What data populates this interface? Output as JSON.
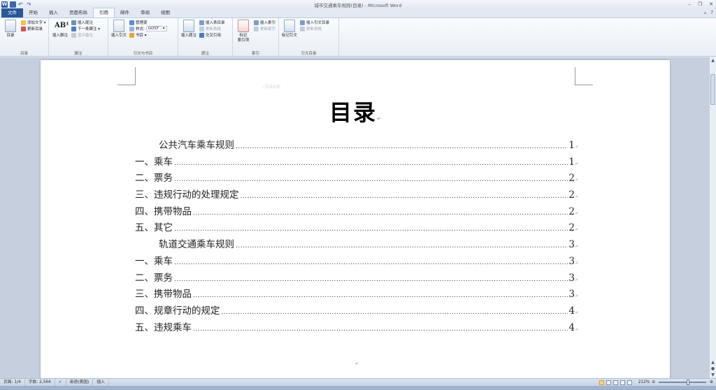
{
  "window": {
    "title": "城市交通乘车规则(目录) - Microsoft Word",
    "controls": [
      "–",
      "❐",
      "✕"
    ]
  },
  "qat": {
    "word": "W",
    "undo": "↶",
    "redo": "↷"
  },
  "tabs": [
    "文件",
    "开始",
    "插入",
    "页面布局",
    "引用",
    "邮件",
    "审阅",
    "视图"
  ],
  "active_tab": "引用",
  "tab_right": {
    "collapse": "▵",
    "help": "?"
  },
  "ribbon": {
    "toc_group": {
      "label": "目录",
      "toc_button": "目录",
      "add_text": "添加文字 ▾",
      "update_toc": "更新目录"
    },
    "footnote_group": {
      "label": "脚注",
      "insert_footnote": "插入脚注",
      "insert_endnote": "插入尾注",
      "next_footnote": "下一条脚注 ▾",
      "show_notes": "显示备注"
    },
    "citation_group": {
      "label": "引文与书目",
      "insert_citation": "插入引文",
      "manage_sources": "管理源",
      "style_label": "样式:",
      "style_value": "GOST - ▾",
      "bibliography": "书目 ▾"
    },
    "caption_group": {
      "label": "题注",
      "insert_caption": "插入题注",
      "insert_table_of_figures": "插入表目录",
      "update_table": "更新表格",
      "cross_reference": "交叉引用"
    },
    "index_group": {
      "label": "索引",
      "mark_entry": "标记\n索引项",
      "insert_index": "插入索引",
      "update_index": "更新索引"
    },
    "authorities_group": {
      "label": "引文目录",
      "mark_citation": "标记引文",
      "insert_table_of_authorities": "插入引文目录",
      "update_table": "更新表格"
    }
  },
  "document": {
    "heading_hint": "• 目录标题",
    "title": "目录",
    "paragraph_mark": "↵",
    "toc": [
      {
        "text": "公共汽车乘车规则",
        "page": "1",
        "indent": true
      },
      {
        "text": "一、乘车",
        "page": "1",
        "indent": false
      },
      {
        "text": "二、票务",
        "page": "2",
        "indent": false
      },
      {
        "text": "三、违规行动的处理规定",
        "page": "2",
        "indent": false
      },
      {
        "text": "四、携带物品",
        "page": "2",
        "indent": false
      },
      {
        "text": "五、其它",
        "page": "2",
        "indent": false
      },
      {
        "text": "轨道交通乘车规则",
        "page": "3",
        "indent": true
      },
      {
        "text": "一、乘车",
        "page": "3",
        "indent": false
      },
      {
        "text": "二、票务",
        "page": "3",
        "indent": false
      },
      {
        "text": "三、携带物品",
        "page": "3",
        "indent": false
      },
      {
        "text": "四、规章行动的规定",
        "page": "4",
        "indent": false
      },
      {
        "text": "五、违规乘车",
        "page": "4",
        "indent": false
      }
    ]
  },
  "statusbar": {
    "page": "页面: 1/4",
    "words": "字数: 2,564",
    "language": "英语(美国)",
    "mode": "插入",
    "zoom": "212%",
    "zoom_minus": "⊖",
    "zoom_plus": "⊕"
  },
  "colors": {
    "accent": "#2b579a",
    "ribbon_bg": "#f8fafd",
    "doc_bg": "#c5cfdd"
  }
}
